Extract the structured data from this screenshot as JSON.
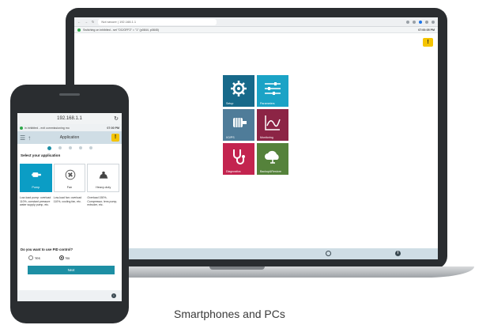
{
  "caption": "Smartphones and PCs",
  "laptop": {
    "browser_url": "Not secure | 192.168.1.1",
    "status_message": "Switching on inhibited - set \"OC/OFF2\" = \"1\" (p0844, p0845)",
    "status_time": "07:00:05 PM",
    "warning_badge": "!",
    "tiles": [
      {
        "label": "Setup",
        "color": "#17698a",
        "icon": "gear-wrench-icon"
      },
      {
        "label": "Parameters",
        "color": "#1ba3c6",
        "icon": "sliders-icon"
      },
      {
        "label": "I/O/PS",
        "color": "#4f7c99",
        "icon": "motor-icon"
      },
      {
        "label": "Monitoring",
        "color": "#8c2445",
        "icon": "chart-icon"
      },
      {
        "label": "Diagnostics",
        "color": "#c3244f",
        "icon": "stethoscope-icon"
      },
      {
        "label": "Backup&Restore",
        "color": "#55823b",
        "icon": "cloud-icon"
      }
    ]
  },
  "phone": {
    "url": "192.168.1.1",
    "status_message": "in inhibited - exit commissioning mo",
    "status_time": "07:00 PM",
    "header_title": "Application",
    "warning_badge": "!",
    "select_heading": "Select your application",
    "cards": [
      {
        "label": "Pump",
        "selected": true,
        "icon": "pump-icon"
      },
      {
        "label": "Fan",
        "selected": false,
        "icon": "fan-icon"
      },
      {
        "label": "Heavy-duty",
        "selected": false,
        "icon": "heavy-duty-icon"
      }
    ],
    "descriptions": [
      "Low-load pump: overload 110%, constant pressure water supply pump, etc.",
      "Low-load fan: overload 110%, cooling fan, etc.",
      "Overload 150%, Compressor, lens pump, extruder, etc."
    ],
    "pid_question": "Do you want to use PID control?",
    "radio_yes": "Yes",
    "radio_no": "No",
    "next_button": "Next"
  }
}
